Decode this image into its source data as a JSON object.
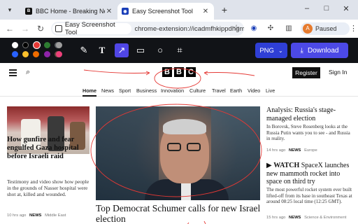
{
  "browser": {
    "tabs": [
      {
        "title": "BBC Home - Breaking News, W"
      },
      {
        "title": "Easy Screenshot Tool"
      }
    ],
    "new_tab": "+",
    "window_controls": {
      "minimize": "–",
      "maximize": "□",
      "close": "✕"
    },
    "address_chip": "Easy Screenshot Tool",
    "url": "chrome-extension://icadmfhkippdhgm...",
    "profile_initial": "A",
    "profile_status": "Paused"
  },
  "screenshot_tool": {
    "colors": [
      "#ffffff",
      "#000000",
      "#e53935",
      "#2e7d32",
      "#5f6368",
      "#2962ff",
      "#fbc02d",
      "#ef6c00",
      "#8e24aa",
      "#6d4c41",
      "#9e9e9e",
      "#ec407a"
    ],
    "tools": [
      "pen-icon",
      "text-icon",
      "arrow-icon",
      "rectangle-icon",
      "circle-icon",
      "crop-icon"
    ],
    "active_tool": "arrow-icon",
    "format": "PNG",
    "download_label": "Download"
  },
  "bbc": {
    "logo": [
      "B",
      "B",
      "C"
    ],
    "register_label": "Register",
    "signin_label": "Sign In",
    "nav": [
      "Home",
      "News",
      "Sport",
      "Business",
      "Innovation",
      "Culture",
      "Travel",
      "Earth",
      "Video",
      "Live"
    ],
    "left_story": {
      "headline": "How gunfire and fear engulfed Gaza hospital before Israeli raid",
      "summary": "Testimony and video show how people in the grounds of Nasser hospital were shot at, killed and wounded.",
      "time": "10 hrs ago",
      "section": "NEWS",
      "region": "Middle East"
    },
    "main_story": {
      "headline": "Top Democrat Schumer calls for new Israel election"
    },
    "right_story_1": {
      "headline": "Analysis: Russia's stage-managed election",
      "summary": "In Borovsk, Steve Rosenberg looks at the Russia Putin wants you to see - and Russia in reality.",
      "time": "14 hrs ago",
      "section": "NEWS",
      "region": "Europe"
    },
    "right_story_2": {
      "watch": "WATCH",
      "headline": "SpaceX launches new mammoth rocket into space on third try",
      "summary": "The most powerful rocket system ever built lifted-off from its base in southeast Texas at around 08:25 local time (12:25 GMT).",
      "time": "15 hrs ago",
      "section": "NEWS",
      "region": "Science & Environment"
    }
  }
}
